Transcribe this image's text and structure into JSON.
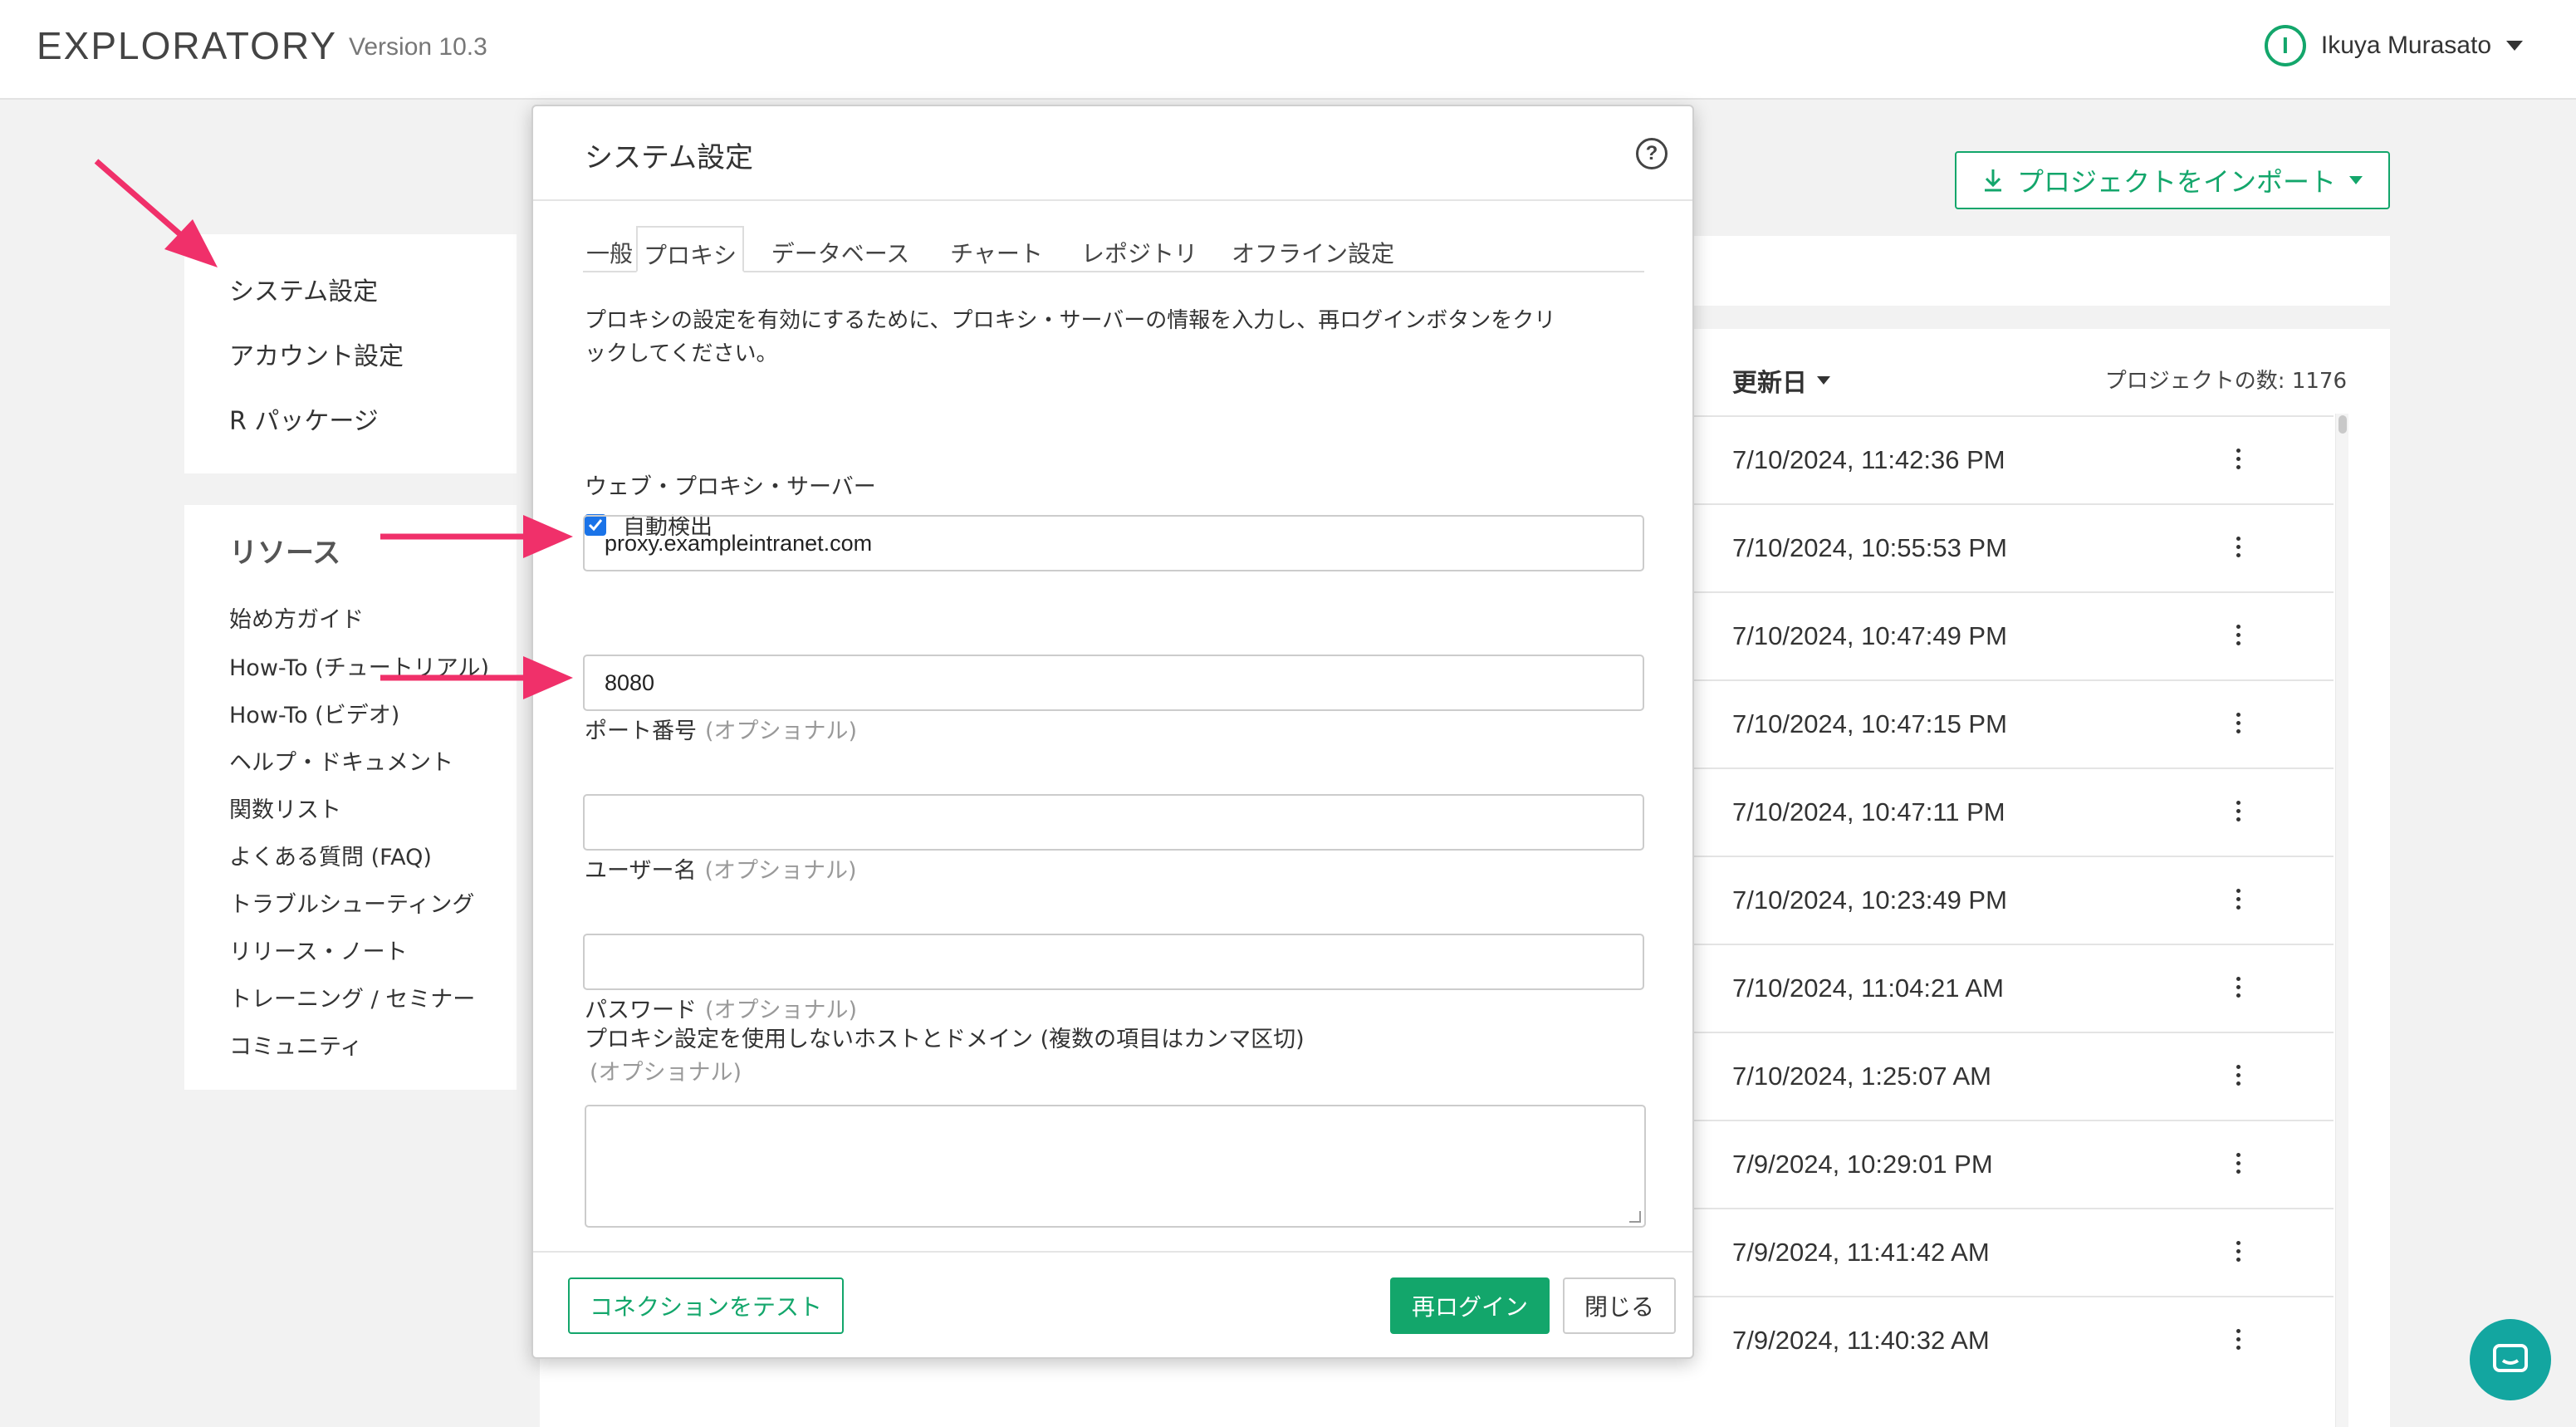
{
  "header": {
    "logo": "EXPLORATORY",
    "version": "Version 10.3",
    "user_initial": "I",
    "user_name": "Ikuya Murasato"
  },
  "sidebar": {
    "settings_links": [
      "システム設定",
      "アカウント設定",
      "R パッケージ"
    ],
    "resources_title": "リソース",
    "resources": [
      "始め方ガイド",
      "How-To (チュートリアル)",
      "How-To (ビデオ)",
      "ヘルプ・ドキュメント",
      "関数リスト",
      "よくある質問 (FAQ)",
      "トラブルシューティング",
      "リリース・ノート",
      "トレーニング / セミナー",
      "コミュニティ"
    ]
  },
  "projects": {
    "import_label": "プロジェクトをインポート",
    "sort_label": "更新日",
    "count_label": "プロジェクトの数: 1176",
    "dates": [
      "7/10/2024, 11:42:36 PM",
      "7/10/2024, 10:55:53 PM",
      "7/10/2024, 10:47:49 PM",
      "7/10/2024, 10:47:15 PM",
      "7/10/2024, 10:47:11 PM",
      "7/10/2024, 10:23:49 PM",
      "7/10/2024, 11:04:21 AM",
      "7/10/2024, 1:25:07 AM",
      "7/9/2024, 10:29:01 PM",
      "7/9/2024, 11:41:42 AM",
      "7/9/2024, 11:40:32 AM"
    ]
  },
  "modal": {
    "title": "システム設定",
    "help": "?",
    "tabs": [
      "一般",
      "プロキシ",
      "データベース",
      "チャート",
      "レポジトリ",
      "オフライン設定"
    ],
    "active_tab": "プロキシ",
    "intro_line1": "プロキシの設定を有効にするために、プロキシ・サーバーの情報を入力し、再ログインボタンをクリ",
    "intro_line2": "ックしてください。",
    "auto_detect_label": "自動検出",
    "auto_detect_checked": true,
    "proxy_server_label": "ウェブ・プロキシ・サーバー",
    "proxy_server_value": "proxy.exampleintranet.com",
    "port_label": "ポート番号",
    "optional": "(オプショナル)",
    "port_value": "8080",
    "username_label": "ユーザー名",
    "username_value": "",
    "password_label": "パスワード",
    "password_value": "",
    "bypass_label": "プロキシ設定を使用しないホストとドメイン (複数の項目はカンマ区切)",
    "bypass_value": "",
    "test_button": "コネクションをテスト",
    "relogin_button": "再ログイン",
    "close_button": "閉じる"
  },
  "colors": {
    "accent": "#13a66b",
    "arrow": "#f0306a",
    "chat": "#13a6a0"
  }
}
